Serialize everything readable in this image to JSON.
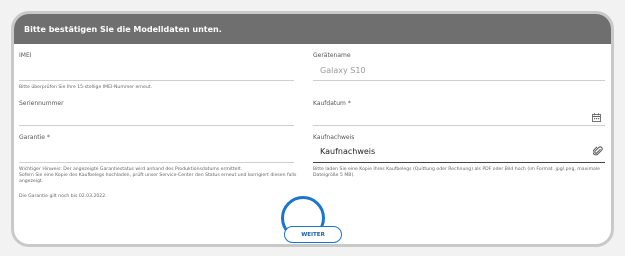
{
  "header": {
    "title": "Bitte bestätigen Sie die Modelldaten unten."
  },
  "left": {
    "imei_label": "IMEI",
    "imei_hint": "Bitte überprüfen Sie Ihre 15-stellige IMEI-Nummer erneut.",
    "serial_label": "Seriennummer",
    "warranty_label": "Garantie *",
    "warranty_note_1": "Wichtiger Hinweis: Der angezeigte Garantiestatus wird anhand des Produktionsdatums ermittelt.",
    "warranty_note_2": "Sofern Sie eine Kopie des Kaufbelegs hochladen, prüft unser Service-Center den Status erneut und korrigiert diesen falls",
    "warranty_note_3": "angezeigt.",
    "warranty_valid": "Die Garantie gilt noch bis 02.03.2022."
  },
  "right": {
    "device_label": "Gerätename",
    "device_value": "Galaxy S10",
    "purchase_date_label": "Kaufdatum *",
    "proof_label": "Kaufnachweis",
    "proof_value": "Kaufnachweis",
    "proof_hint_1": "Bitte laden Sie eine Kopie Ihres Kaufbelegs (Quittung oder Rechnung) als PDF oder Bild hoch (im Format .jpg/.png, maximale",
    "proof_hint_2": "Dateigröße 5 MB)."
  },
  "actions": {
    "next_label": "WEITER"
  },
  "icons": {
    "calendar": "calendar-icon",
    "attach": "paperclip-icon"
  },
  "colors": {
    "header_bg": "#6f6f6f",
    "accent": "#1a75cf"
  }
}
